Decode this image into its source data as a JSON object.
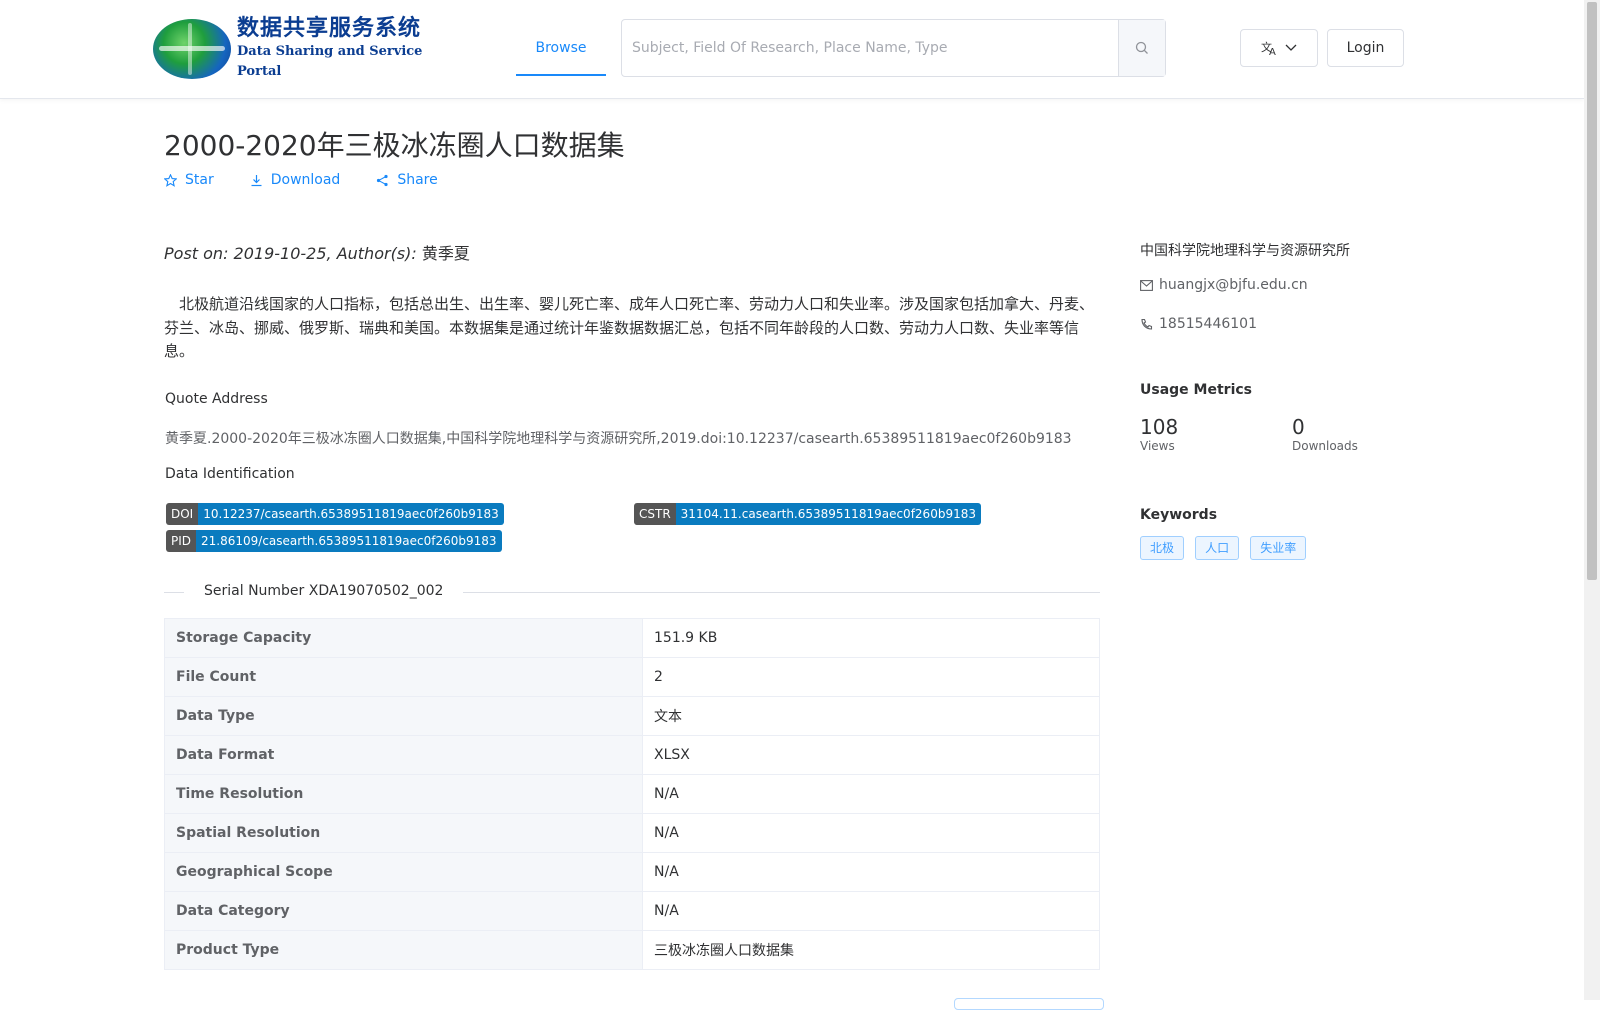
{
  "header": {
    "logo_cn": "数据共享服务系统",
    "logo_en": "Data Sharing and Service Portal",
    "nav_browse": "Browse",
    "search_placeholder": "Subject, Field Of Research, Place Name, Type",
    "language_icon": "translate-icon",
    "login": "Login"
  },
  "dataset": {
    "title": "2000-2020年三极冰冻圈人口数据集",
    "actions": {
      "star": "Star",
      "download": "Download",
      "share": "Share"
    },
    "post_on_label": "Post on: 2019-10-25, Author(s):",
    "author": "黄季夏",
    "description": "北极航道沿线国家的人口指标，包括总出生、出生率、婴儿死亡率、成年人口死亡率、劳动力人口和失业率。涉及国家包括加拿大、丹麦、芬兰、冰岛、挪威、俄罗斯、瑞典和美国。本数据集是通过统计年鉴数据数据汇总，包括不同年龄段的人口数、劳动力人口数、失业率等信息。",
    "quote_label": "Quote Address",
    "quote": "黄季夏.2000-2020年三极冰冻圈人口数据集,中国科学院地理科学与资源研究所,2019.doi:10.12237/casearth.65389511819aec0f260b9183",
    "identification_label": "Data Identification",
    "identifiers": {
      "doi_key": "DOI",
      "doi_value": "10.12237/casearth.65389511819aec0f260b9183",
      "cstr_key": "CSTR",
      "cstr_value": "31104.11.casearth.65389511819aec0f260b9183",
      "pid_key": "PID",
      "pid_value": "21.86109/casearth.65389511819aec0f260b9183"
    },
    "serial_number": "Serial Number XDA19070502_002",
    "properties": [
      {
        "label": "Storage Capacity",
        "value": "151.9 KB"
      },
      {
        "label": "File Count",
        "value": "2"
      },
      {
        "label": "Data Type",
        "value": "文本"
      },
      {
        "label": "Data Format",
        "value": "XLSX"
      },
      {
        "label": "Time Resolution",
        "value": "N/A"
      },
      {
        "label": "Spatial Resolution",
        "value": "N/A"
      },
      {
        "label": "Geographical Scope",
        "value": "N/A"
      },
      {
        "label": "Data Category",
        "value": "N/A"
      },
      {
        "label": "Product Type",
        "value": "三极冰冻圈人口数据集"
      }
    ]
  },
  "sidebar": {
    "institution": "中国科学院地理科学与资源研究所",
    "email": "huangjx@bjfu.edu.cn",
    "phone": "18515446101",
    "usage_title": "Usage Metrics",
    "views_value": "108",
    "views_label": "Views",
    "downloads_value": "0",
    "downloads_label": "Downloads",
    "keywords_title": "Keywords",
    "keywords": [
      "北极",
      "人口",
      "失业率"
    ]
  },
  "colors": {
    "accent": "#1989fa",
    "badge_value": "#0a7bbf",
    "badge_key": "#555555",
    "logo": "#0b3d91"
  }
}
